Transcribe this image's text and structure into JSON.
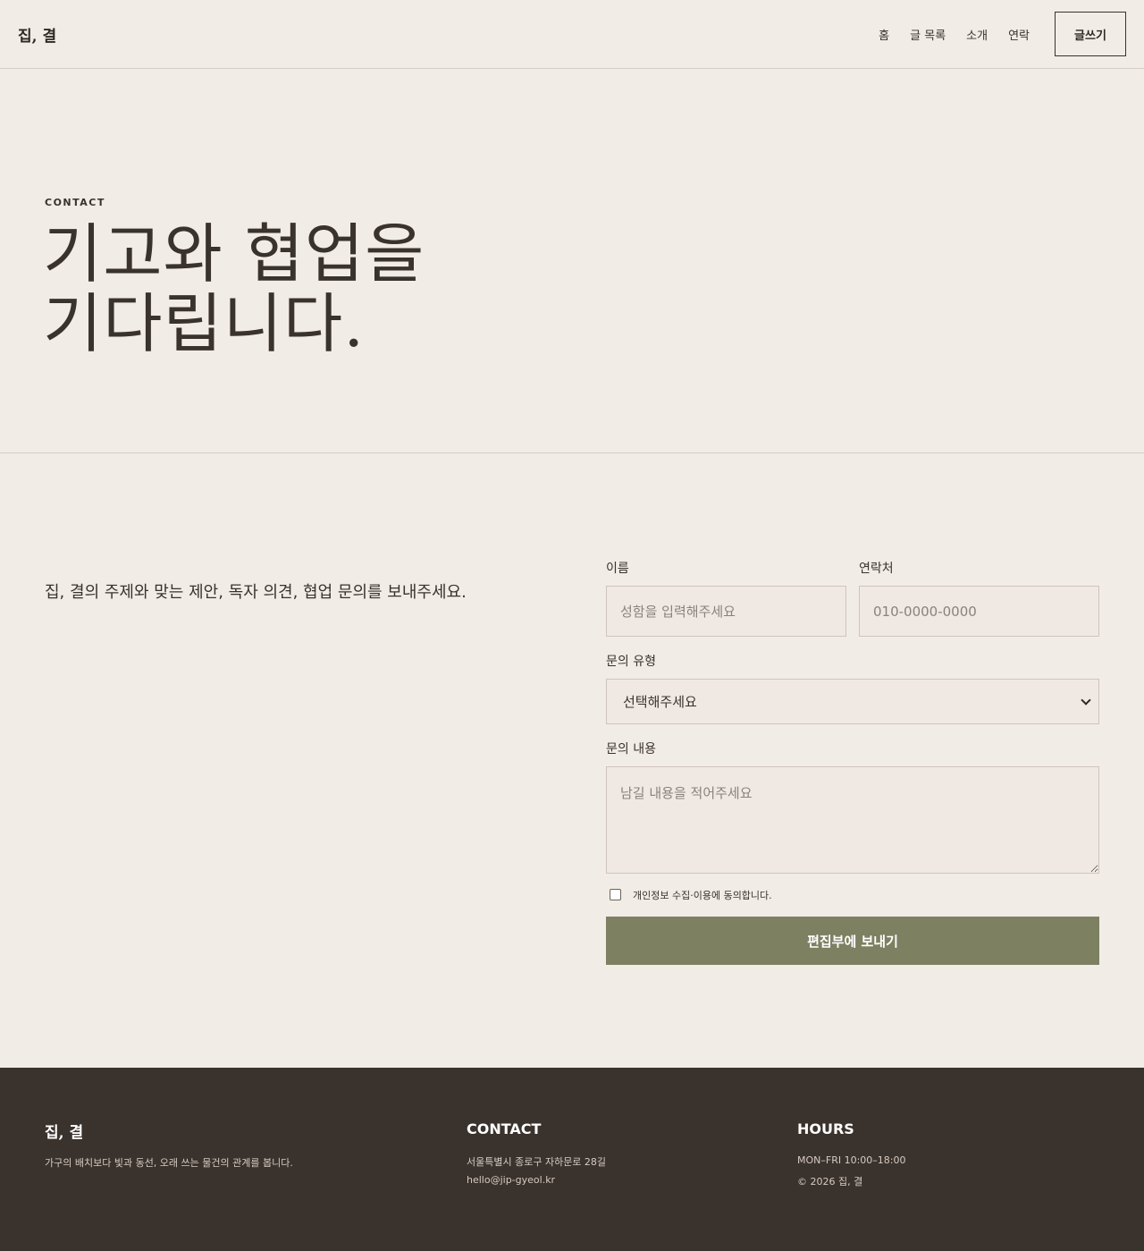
{
  "header": {
    "brand": "집, 결",
    "nav": [
      "홈",
      "글 목록",
      "소개",
      "연락"
    ],
    "write_button": "글쓰기"
  },
  "hero": {
    "eyebrow": "CONTACT",
    "title_line1": "기고와 협업을",
    "title_line2": "기다립니다."
  },
  "intro": "집, 결의 주제와 맞는 제안, 독자 의견, 협업 문의를 보내주세요.",
  "form": {
    "name_label": "이름",
    "name_placeholder": "성함을 입력해주세요",
    "phone_label": "연락처",
    "phone_placeholder": "010-0000-0000",
    "type_label": "문의 유형",
    "type_selected": "선택해주세요",
    "message_label": "문의 내용",
    "message_placeholder": "남길 내용을 적어주세요",
    "consent": "개인정보 수집·이용에 동의합니다.",
    "submit": "편집부에 보내기"
  },
  "footer": {
    "brand": "집, 결",
    "tagline": "가구의 배치보다 빛과 동선, 오래 쓰는 물건의 관계를 봅니다.",
    "contact_heading": "CONTACT",
    "address": "서울특별시 종로구 자하문로 28길",
    "email": "hello@jip-gyeol.kr",
    "hours_heading": "HOURS",
    "hours": "MON–FRI 10:00–18:00",
    "copyright": "© 2026 집, 결"
  },
  "colors": {
    "background": "#f2ece6",
    "text": "#3a322c",
    "accent_button": "#7d8061",
    "footer_bg": "#3a322c"
  }
}
